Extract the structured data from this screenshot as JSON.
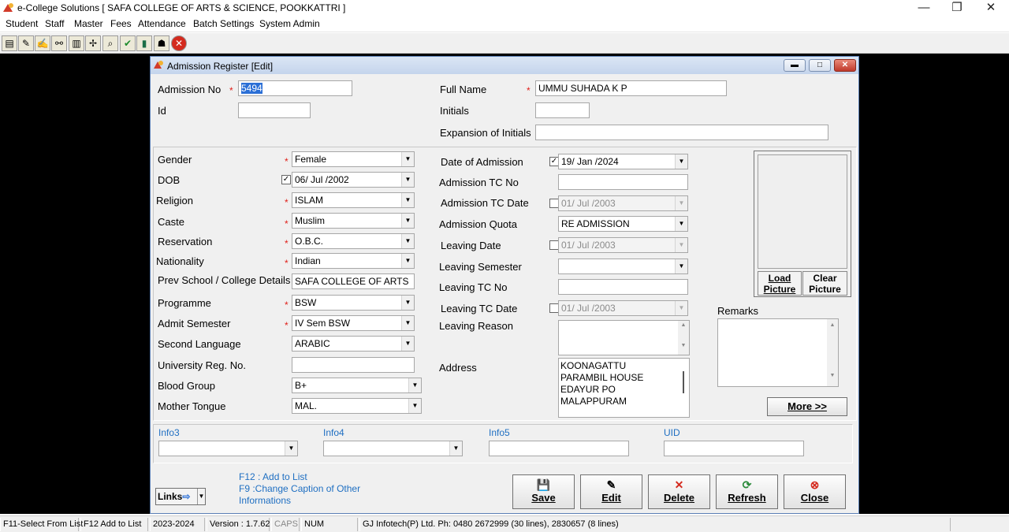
{
  "window": {
    "title": "e-College Solutions [ SAFA COLLEGE OF ARTS & SCIENCE, POOKKATTRI ]",
    "minimize": "—",
    "restore": "❐",
    "close": "✕"
  },
  "menu": [
    "Student",
    "Staff",
    "Master",
    "Fees",
    "Attendance",
    "Batch Settings",
    "System Admin"
  ],
  "toolbar_icons": [
    "book-icon",
    "pencil-icon",
    "edit-icon",
    "link-icon",
    "books-icon",
    "network-icon",
    "search-icon",
    "check-icon",
    "document-icon",
    "user-icon",
    "exit-icon"
  ],
  "dialog": {
    "title": "Admission Register [Edit]",
    "admission_no_label": "Admission No",
    "admission_no": "5494",
    "id_label": "Id",
    "id_value": "",
    "full_name_label": "Full Name",
    "full_name": "UMMU SUHADA K P",
    "initials_label": "Initials",
    "initials": "",
    "expansion_label": "Expansion of Initials",
    "expansion": "",
    "left_fields": {
      "gender_label": "Gender",
      "gender": "Female",
      "dob_label": "DOB",
      "dob": "06/ Jul /2002",
      "religion_label": "Religion",
      "religion": "ISLAM",
      "caste_label": "Caste",
      "caste": "Muslim",
      "reservation_label": "Reservation",
      "reservation": "O.B.C.",
      "nationality_label": "Nationality",
      "nationality": "Indian",
      "prev_school_label": "Prev School / College Details",
      "prev_school": "SAFA COLLEGE OF ARTS",
      "programme_label": "Programme",
      "programme": "BSW",
      "admit_semester_label": "Admit Semester",
      "admit_semester": "IV Sem BSW",
      "second_language_label": "Second Language",
      "second_language": "ARABIC",
      "university_reg_label": "University Reg. No.",
      "university_reg": "",
      "blood_group_label": "Blood Group",
      "blood_group": "B+",
      "mother_tongue_label": "Mother Tongue",
      "mother_tongue": "MAL."
    },
    "mid_fields": {
      "date_of_admission_label": "Date of Admission",
      "date_of_admission": "19/ Jan /2024",
      "admission_tc_no_label": "Admission TC No",
      "admission_tc_no": "",
      "admission_tc_date_label": "Admission TC Date",
      "admission_tc_date": "01/ Jul /2003",
      "admission_quota_label": "Admission Quota",
      "admission_quota": "RE ADMISSION",
      "leaving_date_label": "Leaving Date",
      "leaving_date": "01/ Jul /2003",
      "leaving_semester_label": "Leaving Semester",
      "leaving_semester": "",
      "leaving_tc_no_label": "Leaving TC No",
      "leaving_tc_no": "",
      "leaving_tc_date_label": "Leaving TC Date",
      "leaving_tc_date": "01/ Jul /2003",
      "leaving_reason_label": "Leaving Reason",
      "address_label": "Address",
      "address_lines": [
        "KOONAGATTU",
        "PARAMBIL HOUSE",
        "EDAYUR PO",
        "MALAPPURAM"
      ]
    },
    "picture": {
      "load_1": "Load",
      "load_2": "Picture",
      "clear_1": "Clear",
      "clear_2": "Picture"
    },
    "remarks_label": "Remarks",
    "more_button": "More >>",
    "info": {
      "info3": "Info3",
      "info4": "Info4",
      "info5": "Info5",
      "uid": "UID"
    },
    "links_button": "Links",
    "hints": [
      "F12 : Add to List",
      "F9 :Change Caption of Other",
      "Informations"
    ],
    "buttons": {
      "save": "Save",
      "edit": "Edit",
      "delete": "Delete",
      "refresh": "Refresh",
      "close": "Close"
    },
    "required_mark": "*",
    "check_mark": "✓"
  },
  "statusbar": [
    "F11-Select From List",
    "F12 Add to List",
    "2023-2024",
    "Version : 1.7.62",
    "CAPS",
    "NUM",
    "GJ Infotech(P) Ltd. Ph: 0480 2672999 (30 lines), 2830657 (8 lines)"
  ]
}
